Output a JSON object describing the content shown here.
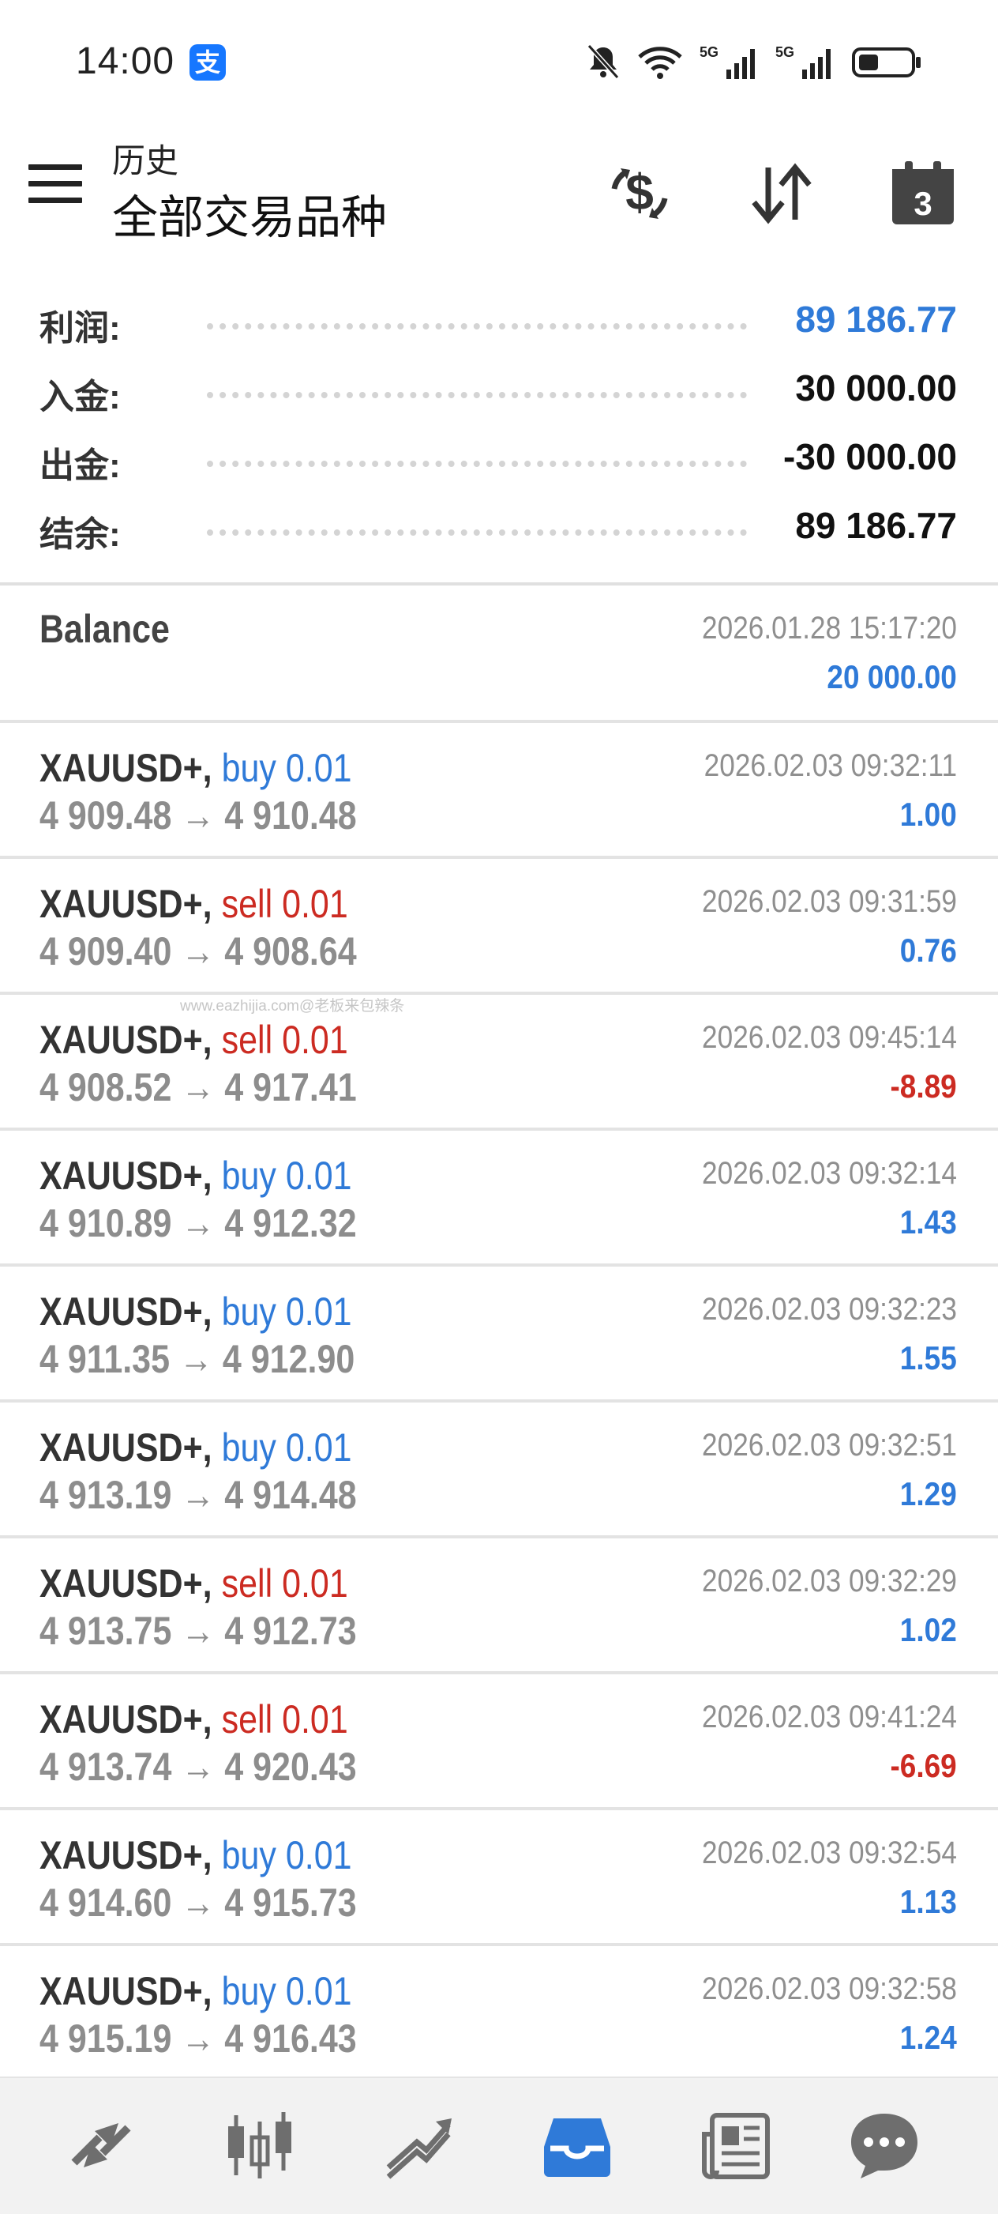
{
  "status_bar": {
    "time": "14:00",
    "alipay_badge": "支",
    "icons": [
      "bell-muted-icon",
      "wifi-icon",
      "signal-5g-icon",
      "signal-5g-icon",
      "battery-icon"
    ],
    "network_label_1": "5G",
    "network_label_2": "5G"
  },
  "toolbar": {
    "subtitle": "历史",
    "title": "全部交易品种",
    "calendar_day": "3",
    "icons": [
      "menu-icon",
      "currency-refresh-icon",
      "sort-icon",
      "calendar-icon"
    ]
  },
  "summary": {
    "rows": [
      {
        "label": "利润:",
        "value": "89 186.77",
        "color": "#2f7ad8"
      },
      {
        "label": "入金:",
        "value": "30 000.00",
        "color": "#111111"
      },
      {
        "label": "出金:",
        "value": "-30 000.00",
        "color": "#111111"
      },
      {
        "label": "结余:",
        "value": "89 186.77",
        "color": "#111111"
      }
    ]
  },
  "balance_entry": {
    "title": "Balance",
    "time": "2026.01.28 15:17:20",
    "amount": "20 000.00"
  },
  "trades": [
    {
      "symbol": "XAUUSD+,",
      "side": "buy 0.01",
      "prices": "4 909.48 → 4 910.48",
      "time": "2026.02.03 09:32:11",
      "profit": "1.00"
    },
    {
      "symbol": "XAUUSD+,",
      "side": "sell 0.01",
      "prices": "4 909.40 → 4 908.64",
      "time": "2026.02.03 09:31:59",
      "profit": "0.76"
    },
    {
      "symbol": "XAUUSD+,",
      "side": "sell 0.01",
      "prices": "4 908.52 → 4 917.41",
      "time": "2026.02.03 09:45:14",
      "profit": "-8.89"
    },
    {
      "symbol": "XAUUSD+,",
      "side": "buy 0.01",
      "prices": "4 910.89 → 4 912.32",
      "time": "2026.02.03 09:32:14",
      "profit": "1.43"
    },
    {
      "symbol": "XAUUSD+,",
      "side": "buy 0.01",
      "prices": "4 911.35 → 4 912.90",
      "time": "2026.02.03 09:32:23",
      "profit": "1.55"
    },
    {
      "symbol": "XAUUSD+,",
      "side": "buy 0.01",
      "prices": "4 913.19 → 4 914.48",
      "time": "2026.02.03 09:32:51",
      "profit": "1.29"
    },
    {
      "symbol": "XAUUSD+,",
      "side": "sell 0.01",
      "prices": "4 913.75 → 4 912.73",
      "time": "2026.02.03 09:32:29",
      "profit": "1.02"
    },
    {
      "symbol": "XAUUSD+,",
      "side": "sell 0.01",
      "prices": "4 913.74 → 4 920.43",
      "time": "2026.02.03 09:41:24",
      "profit": "-6.69"
    },
    {
      "symbol": "XAUUSD+,",
      "side": "buy 0.01",
      "prices": "4 914.60 → 4 915.73",
      "time": "2026.02.03 09:32:54",
      "profit": "1.13"
    },
    {
      "symbol": "XAUUSD+,",
      "side": "buy 0.01",
      "prices": "4 915.19 → 4 916.43",
      "time": "2026.02.03 09:32:58",
      "profit": "1.24"
    }
  ],
  "watermark": "www.eazhijia.com@老板来包辣条",
  "bottom_nav": {
    "items": [
      "quotes-icon",
      "chart-icon",
      "trade-icon",
      "history-icon",
      "news-icon",
      "chat-icon"
    ],
    "active": "history-icon"
  },
  "colors": {
    "buy": "#2f7ad8",
    "sell": "#cc2b22",
    "positive_profit": "#2f7ad8",
    "negative_profit": "#cc2b22",
    "active_nav": "#2f7ad8",
    "inactive_nav": "#6e6e6e"
  }
}
